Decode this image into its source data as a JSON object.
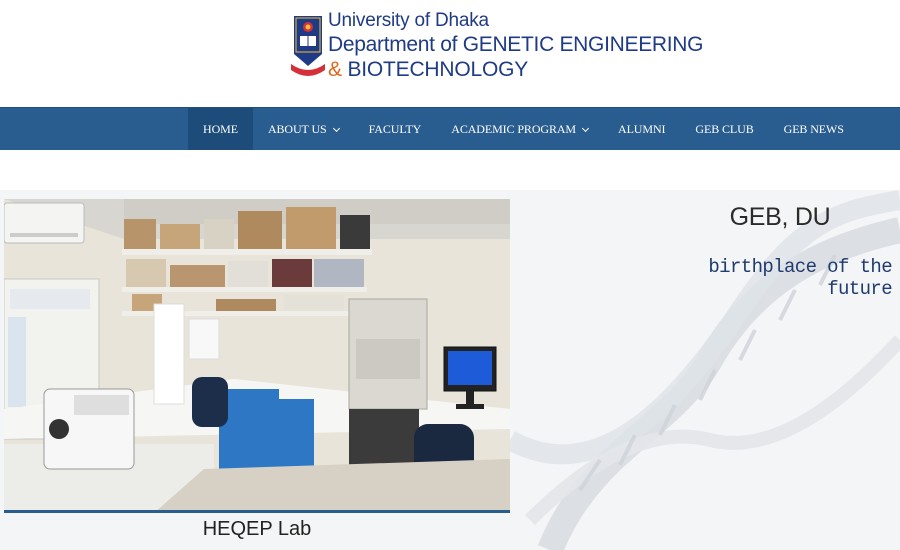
{
  "header": {
    "university": "University of Dhaka",
    "department_line1": "Department of GENETIC ENGINEERING",
    "department_amp": "&",
    "department_line2": "BIOTECHNOLOGY"
  },
  "nav": {
    "items": [
      {
        "label": "HOME",
        "active": true
      },
      {
        "label": "ABOUT US",
        "has_dropdown": true
      },
      {
        "label": "FACULTY"
      },
      {
        "label": "ACADEMIC PROGRAM",
        "has_dropdown": true
      },
      {
        "label": "ALUMNI"
      },
      {
        "label": "GEB CLUB"
      },
      {
        "label": "GEB NEWS"
      }
    ]
  },
  "hero": {
    "slide_caption": "HEQEP Lab",
    "title": "GEB, DU",
    "subtitle": "birthplace of the future"
  },
  "colors": {
    "nav_bg": "#2a5d8f",
    "nav_active": "#1e4c7a",
    "brand_blue": "#1f3b86",
    "brand_orange": "#e0661d"
  }
}
